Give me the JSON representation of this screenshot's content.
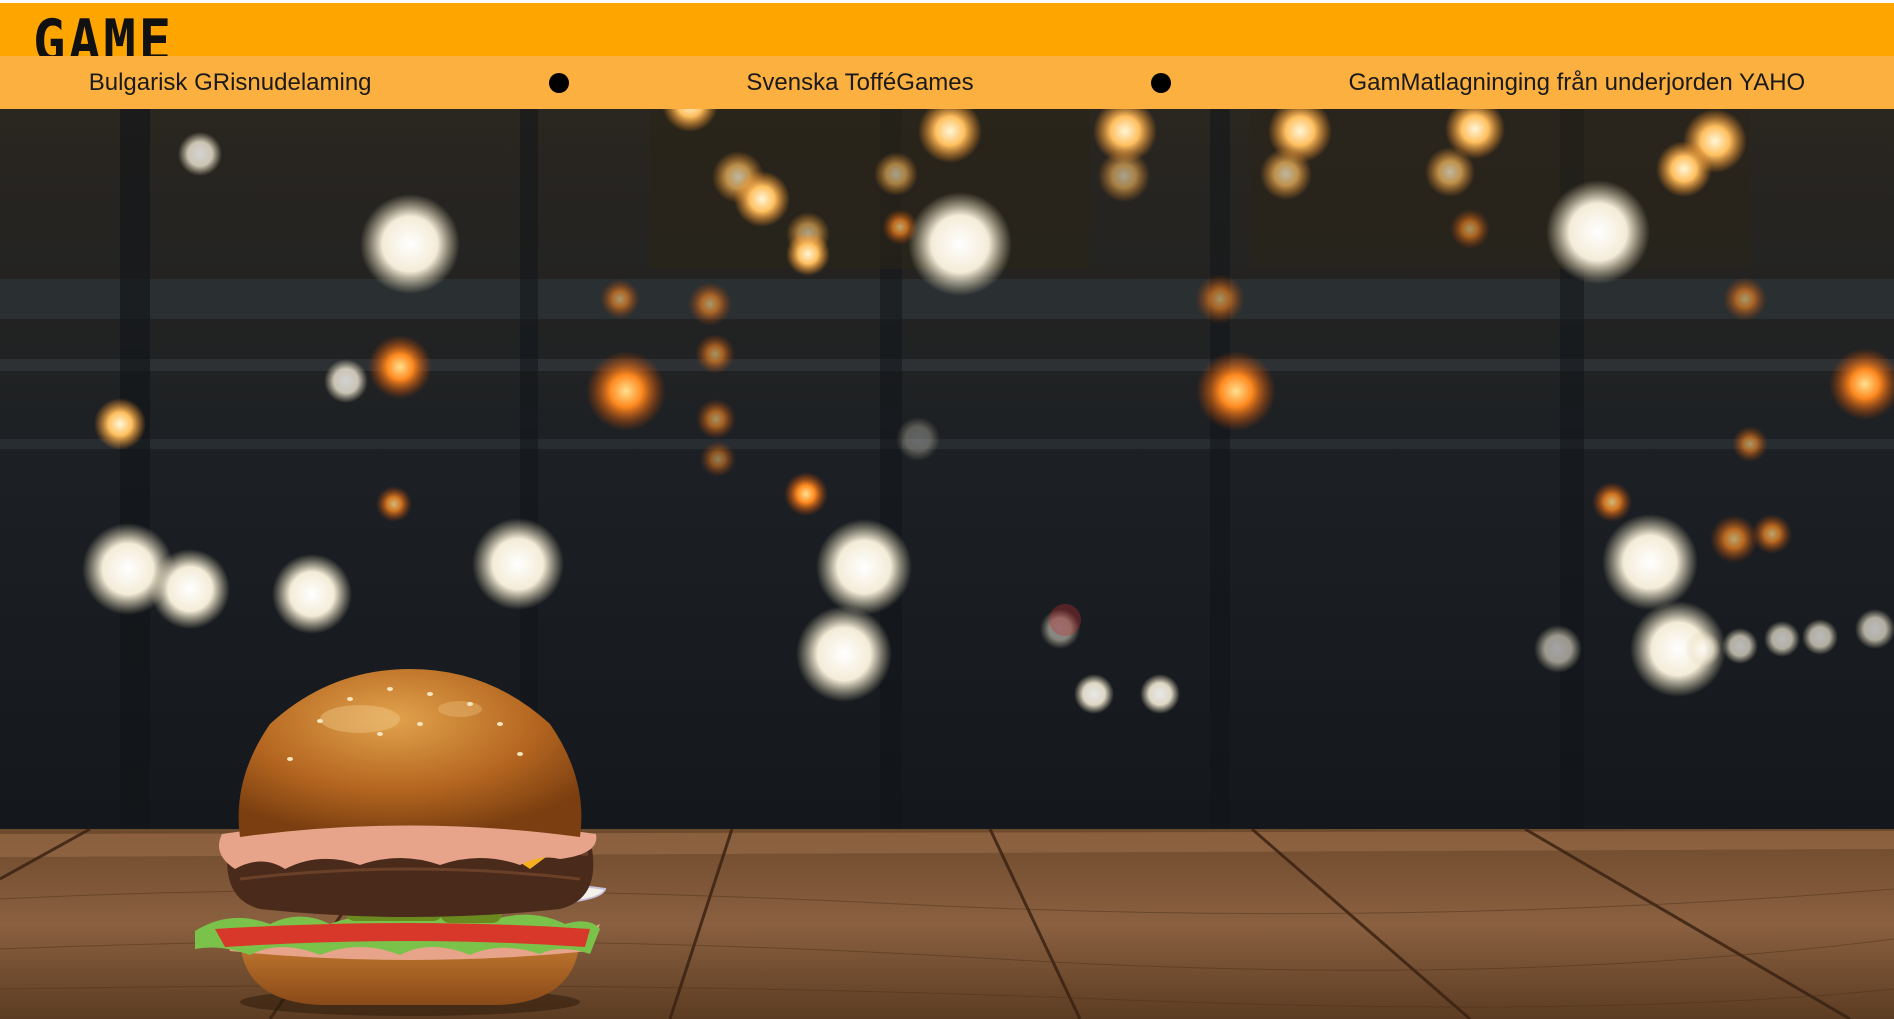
{
  "header": {
    "logo_text": "GAME",
    "bg_color": "#ffa500"
  },
  "nav": {
    "bg_color": "#fbb040",
    "items": [
      {
        "label": "Bulgarisk GRisnudelaming"
      },
      {
        "label": "Svenska TofféGames"
      },
      {
        "label": "GamMatlagninging från underjorden YAHO"
      }
    ],
    "separator_icon": "black-dot-icon"
  },
  "hero": {
    "image": "burger-on-wooden-table-with-bokeh-city-lights",
    "icon": "burger-icon"
  }
}
